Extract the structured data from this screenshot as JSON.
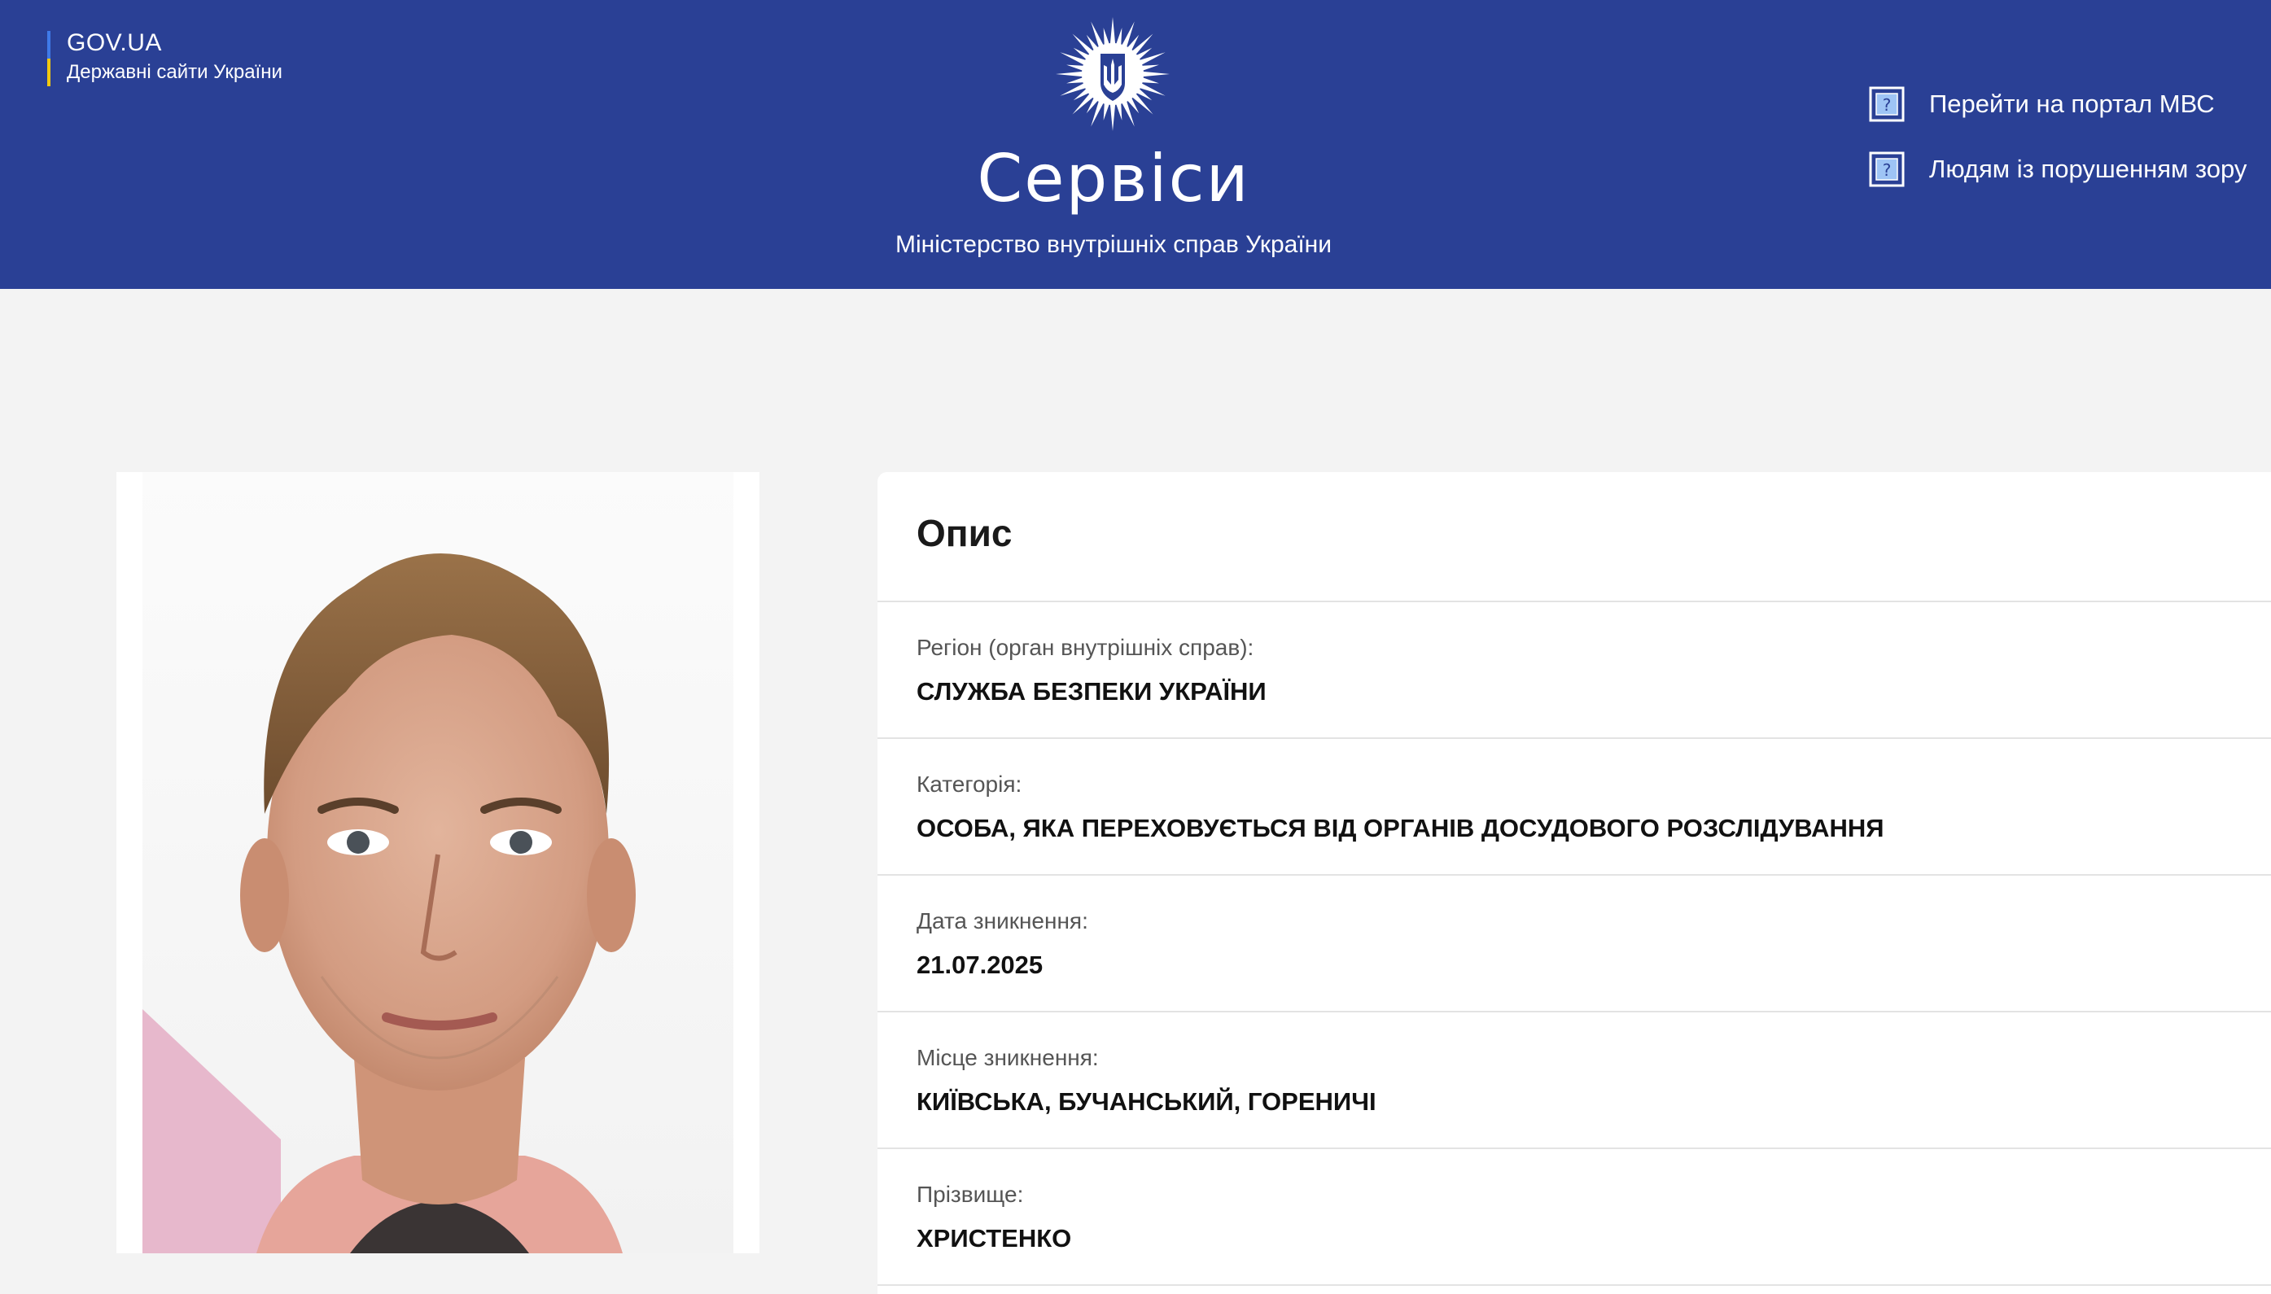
{
  "header": {
    "govua_title": "GOV.UA",
    "govua_subtitle": "Державні сайти України",
    "site_title": "Сервіси",
    "site_subtitle": "Міністерство внутрішніх справ України",
    "links": [
      {
        "label": "Перейти на портал МВС",
        "icon": "help-square-icon"
      },
      {
        "label": "Людям із порушенням зору",
        "icon": "help-square-icon"
      }
    ],
    "emblem_icon": "police-star-trident-emblem-icon"
  },
  "colors": {
    "header_bg": "#2a4095",
    "page_bg": "#f3f3f3",
    "flag_blue": "#3f7ae8",
    "flag_yellow": "#f2c80f"
  },
  "photo": {
    "icon": "person-portrait-photo"
  },
  "card": {
    "title": "Опис",
    "rows": [
      {
        "label": "Регіон (орган внутрішніх справ):",
        "value": "СЛУЖБА БЕЗПЕКИ УКРАЇНИ"
      },
      {
        "label": "Категорія:",
        "value": "ОСОБА, ЯКА ПЕРЕХОВУЄТЬСЯ ВІД ОРГАНІВ ДОСУДОВОГО РОЗСЛІДУВАННЯ"
      },
      {
        "label": "Дата зникнення:",
        "value": "21.07.2025"
      },
      {
        "label": "Місце зникнення:",
        "value": "КИЇВСЬКА, БУЧАНСЬКИЙ, ГОРЕНИЧІ"
      },
      {
        "label": "Прізвище:",
        "value": "ХРИСТЕНКО"
      }
    ]
  }
}
